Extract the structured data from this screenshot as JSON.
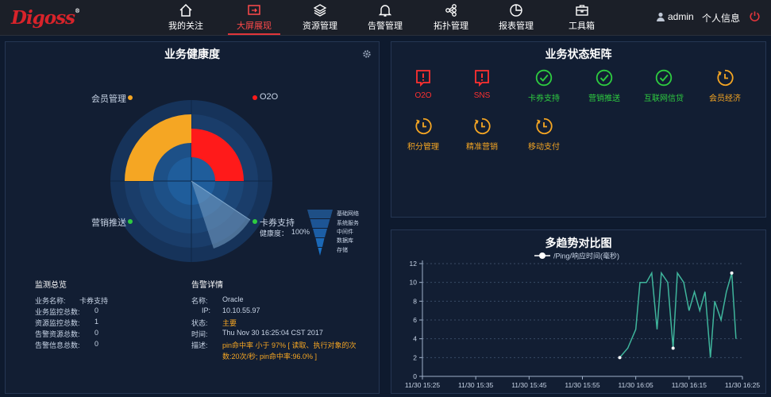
{
  "logo": {
    "text": "Digoss",
    "reg": "®"
  },
  "nav": [
    {
      "label": "我的关注",
      "icon": "home-icon"
    },
    {
      "label": "大屏展现",
      "icon": "screen-icon"
    },
    {
      "label": "资源管理",
      "icon": "layers-icon"
    },
    {
      "label": "告警管理",
      "icon": "bell-icon"
    },
    {
      "label": "拓扑管理",
      "icon": "topology-icon"
    },
    {
      "label": "报表管理",
      "icon": "pie-icon"
    },
    {
      "label": "工具箱",
      "icon": "toolbox-icon"
    }
  ],
  "active_nav": "大屏展现",
  "user": {
    "name": "admin",
    "profile": "个人信息"
  },
  "health": {
    "title": "业务健康度",
    "labels": {
      "member": "会员管理",
      "o2o": "O2O",
      "marketing": "营销推送",
      "coupon": "卡券支持"
    },
    "health_label": "健康度：",
    "health_value": "100%",
    "legend": [
      "基础网络",
      "系统服务",
      "中间件",
      "数据库",
      "存储"
    ],
    "colors": {
      "member": "#f5a623",
      "o2o": "#ff1a1a",
      "marketing": "#2ecc40",
      "coupon": "#2ecc40"
    }
  },
  "overview": {
    "title": "监测总览",
    "rows": [
      {
        "k": "业务名称:",
        "v": "卡券支持"
      },
      {
        "k": "业务监控总数:",
        "v": "0"
      },
      {
        "k": "资源监控总数:",
        "v": "1"
      },
      {
        "k": "告警资源总数:",
        "v": "0"
      },
      {
        "k": "告警信息总数:",
        "v": "0"
      }
    ]
  },
  "alarm": {
    "title": "告警详情",
    "name_k": "名称:",
    "name_v": "Oracle",
    "ip_k": "IP:",
    "ip_v": "10.10.55.97",
    "status_k": "状态:",
    "status_v": "主要",
    "time_k": "时间:",
    "time_v": "Thu Nov 30 16:25:04 CST 2017",
    "desc_k": "描述:",
    "desc_l1": "pin命中率 小于 97% [ 读取、执行对象的次",
    "desc_l2": "数:20次/秒; pin命中率:96.0% ]"
  },
  "matrix": {
    "title": "业务状态矩阵",
    "items": [
      {
        "label": "O2O",
        "status": "alert",
        "color": "#ff3030"
      },
      {
        "label": "SNS",
        "status": "alert",
        "color": "#ff3030"
      },
      {
        "label": "卡券支持",
        "status": "ok",
        "color": "#2ecc40"
      },
      {
        "label": "营销推送",
        "status": "ok",
        "color": "#2ecc40"
      },
      {
        "label": "互联网信贷",
        "status": "ok",
        "color": "#2ecc40"
      },
      {
        "label": "会员经济",
        "status": "warn",
        "color": "#f5a623"
      },
      {
        "label": "积分管理",
        "status": "warn",
        "color": "#f5a623"
      },
      {
        "label": "精准营销",
        "status": "warn",
        "color": "#f5a623"
      },
      {
        "label": "移动支付",
        "status": "warn",
        "color": "#f5a623"
      }
    ]
  },
  "trend": {
    "title": "多趋势对比图"
  },
  "chart_data": {
    "type": "line",
    "legend": "/Ping/响应时间(毫秒)",
    "x_ticks": [
      "11/30 15:25",
      "11/30 15:35",
      "11/30 15:45",
      "11/30 15:55",
      "11/30 16:05",
      "11/30 16:15",
      "11/30 16:25"
    ],
    "y_ticks": [
      0,
      2,
      4,
      6,
      8,
      10,
      12
    ],
    "ylim": [
      0,
      12
    ],
    "x_range_minutes": [
      0,
      60
    ],
    "series": [
      {
        "name": "/Ping/响应时间(毫秒)",
        "color": "#3fb59c",
        "x": [
          37,
          38.5,
          40,
          40.8,
          42,
          43,
          44,
          44.8,
          46,
          47,
          47.8,
          49,
          50,
          51,
          52,
          53,
          54,
          54.8,
          56,
          57,
          58,
          58.8
        ],
        "y": [
          2,
          3,
          5,
          10,
          10,
          11,
          5,
          11,
          10,
          3,
          11,
          10,
          7,
          9,
          7,
          9,
          2,
          8,
          6,
          9,
          11,
          4
        ]
      }
    ],
    "highlight_points": [
      [
        37,
        2
      ],
      [
        47,
        3
      ],
      [
        58,
        11
      ]
    ],
    "grid": "horizontal dashed"
  }
}
